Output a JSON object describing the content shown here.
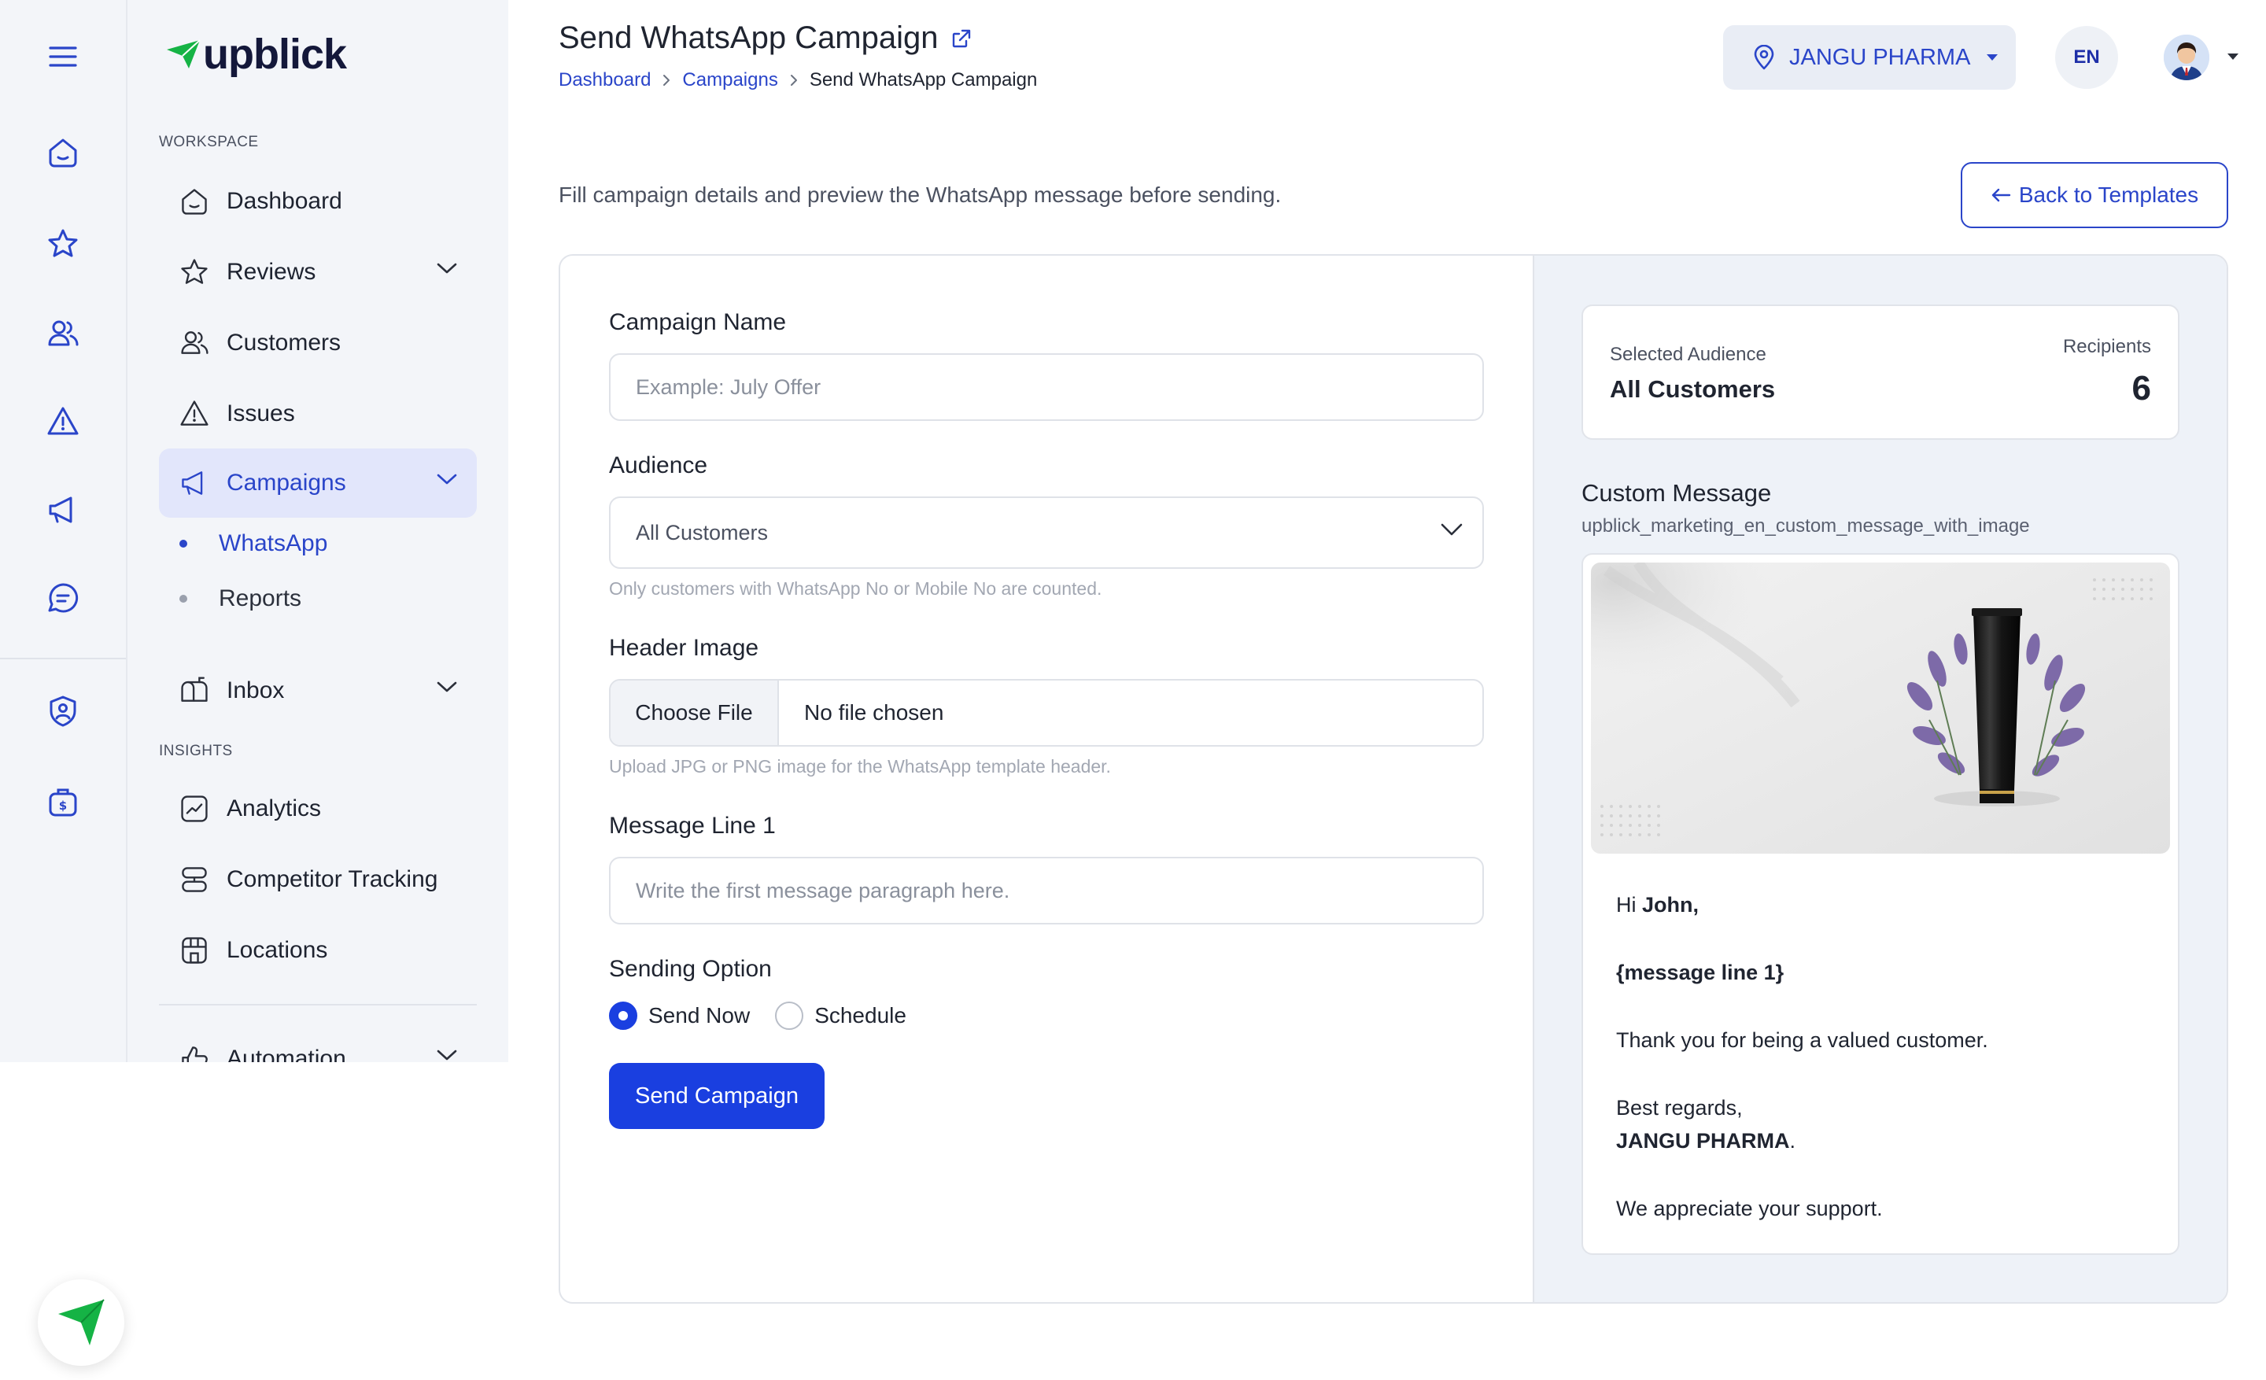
{
  "brand": {
    "name": "upblick",
    "accent": "#2a45c9",
    "green": "#15b345"
  },
  "sidebar": {
    "workspace_label": "WORKSPACE",
    "insights_label": "INSIGHTS",
    "items": [
      {
        "label": "Dashboard",
        "icon": "home-icon"
      },
      {
        "label": "Reviews",
        "icon": "star-icon"
      },
      {
        "label": "Customers",
        "icon": "users-icon"
      },
      {
        "label": "Issues",
        "icon": "warning-icon"
      },
      {
        "label": "Campaigns",
        "icon": "megaphone-icon"
      },
      {
        "label": "Inbox",
        "icon": "mailbox-icon"
      },
      {
        "label": "Analytics",
        "icon": "chart-icon"
      },
      {
        "label": "Competitor Tracking",
        "icon": "server-icon"
      },
      {
        "label": "Locations",
        "icon": "store-icon"
      },
      {
        "label": "Automation",
        "icon": "thumb-icon"
      }
    ],
    "subitems": [
      {
        "label": "WhatsApp"
      },
      {
        "label": "Reports"
      }
    ]
  },
  "header": {
    "title": "Send WhatsApp Campaign",
    "breadcrumb": [
      "Dashboard",
      "Campaigns",
      "Send WhatsApp Campaign"
    ],
    "location": "JANGU PHARMA",
    "language": "EN"
  },
  "intro": "Fill campaign details and preview the WhatsApp message before sending.",
  "back_button": "Back to Templates",
  "form": {
    "campaign_name": {
      "label": "Campaign Name",
      "placeholder": "Example: July Offer"
    },
    "audience": {
      "label": "Audience",
      "value": "All Customers",
      "help": "Only customers with WhatsApp No or Mobile No are counted."
    },
    "header_image": {
      "label": "Header Image",
      "button": "Choose File",
      "filename": "No file chosen",
      "help": "Upload JPG or PNG image for the WhatsApp template header."
    },
    "message_line": {
      "label": "Message Line 1",
      "placeholder": "Write the first message paragraph here."
    },
    "sending": {
      "label": "Sending Option",
      "options": [
        "Send Now",
        "Schedule"
      ],
      "selected": "Send Now"
    },
    "submit": "Send Campaign"
  },
  "preview": {
    "audience_label": "Selected Audience",
    "audience_value": "All Customers",
    "recipients_label": "Recipients",
    "recipients_value": "6",
    "template_title": "Custom Message",
    "template_name": "upblick_marketing_en_custom_message_with_image",
    "greeting_prefix": "Hi ",
    "greeting_name": "John,",
    "placeholder_line": "{message line 1}",
    "thanks": "Thank you for being a valued customer.",
    "regards": "Best regards,",
    "signature": "JANGU PHARMA",
    "signature_suffix": ".",
    "closing": "We appreciate your support."
  }
}
